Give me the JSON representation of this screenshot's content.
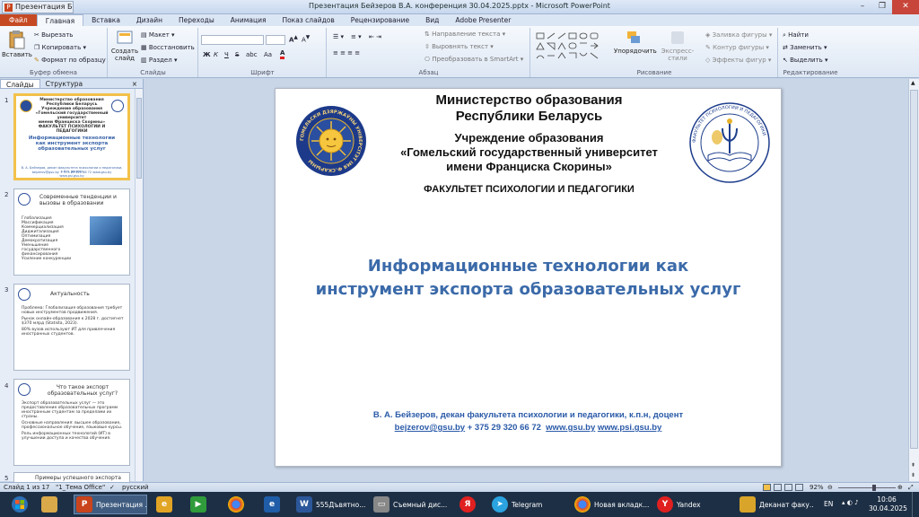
{
  "window": {
    "title": "Презентация Бейзеров В.А. конференция 30.04.2025.pptx - Microsoft PowerPoint",
    "quick_label": "Презентация Бей"
  },
  "tabs": [
    "Файл",
    "Главная",
    "Вставка",
    "Дизайн",
    "Переходы",
    "Анимация",
    "Показ слайдов",
    "Рецензирование",
    "Вид",
    "Adobe Presenter"
  ],
  "ribbon": {
    "clipboard": {
      "paste": "Вставить",
      "cut": "Вырезать",
      "copy": "Копировать",
      "format": "Формат по образцу",
      "label": "Буфер обмена"
    },
    "slides": {
      "new": "Создать слайд",
      "layout": "Макет",
      "reset": "Восстановить",
      "section": "Раздел",
      "label": "Слайды"
    },
    "font": {
      "label": "Шрифт",
      "bold": "Ж",
      "italic": "К",
      "underline": "Ч",
      "strike": "S",
      "shadow": "abc",
      "size_up": "A",
      "size_down": "A",
      "case": "Aa"
    },
    "paragraph": {
      "direction": "Направление текста",
      "align": "Выровнять текст",
      "smartart": "Преобразовать в SmartArt",
      "label": "Абзац"
    },
    "drawing": {
      "arrange": "Упорядочить",
      "quick_styles": "Экспресс-стили",
      "fill": "Заливка фигуры",
      "outline": "Контур фигуры",
      "effects": "Эффекты фигур",
      "label": "Рисование"
    },
    "editing": {
      "find": "Найти",
      "replace": "Заменить",
      "select": "Выделить",
      "label": "Редактирование"
    }
  },
  "panel": {
    "tab_slides": "Слайды",
    "tab_outline": "Структура",
    "close": "×"
  },
  "thumbnails": [
    {
      "num": "1",
      "lines": [
        "Министерство образования",
        "Республики Беларусь",
        "Учреждение образования",
        "«Гомельский государственный университет",
        "имени Франциска Скорины»",
        "ФАКУЛЬТЕТ ПСИХОЛОГИИ И ПЕДАГОГИКИ"
      ],
      "title": "Информационные технологии как инструмент экспорта образовательных услуг",
      "footer": "В. А. Бейзеров, декан факультета психологии и педагогики, к.п.н, доцент",
      "footer2": "bejzerov@gsu.by  + 375 29 320 66 72  www.gsu.by  www.psi.gsu.by"
    },
    {
      "num": "2",
      "title": "Современные тенденции и вызовы в образовании",
      "bullets": [
        "Глобализация",
        "Массификация",
        "Коммерциализация",
        "Диджитализация",
        "Оптимизация",
        "Демократизация",
        "Уменьшение государственного финансирования",
        "Усиление конкуренции"
      ]
    },
    {
      "num": "3",
      "title": "Актуальность",
      "bullets": [
        "Проблема: Глобализация образования требует новых инструментов продвижения.",
        "Рынок онлайн-образования к 2028 г. достигнет $370 млрд (Statista, 2023).",
        "80% вузов используют ИТ для привлечения иностранных студентов."
      ]
    },
    {
      "num": "4",
      "title": "Что такое экспорт образовательных услуг?",
      "bullets": [
        "Экспорт образовательных услуг — это предоставление образовательных программ иностранным студентам за пределами их страны.",
        "Основные направления: высшее образование, профессиональное обучение, языковые курсы.",
        "Роль информационных технологий (ИТ) в улучшении доступа и качества обучения."
      ]
    },
    {
      "num": "5",
      "title": "Примеры успешного экспорта"
    }
  ],
  "slide": {
    "header1": "Министерство образования",
    "header2": "Республики Беларусь",
    "inst1": "Учреждение образования",
    "inst2": "«Гомельский государственный университет",
    "inst3": "имени Франциска Скорины»",
    "faculty": "ФАКУЛЬТЕТ ПСИХОЛОГИИ И ПЕДАГОГИКИ",
    "title1": "Информационные технологии как",
    "title2": "инструмент экспорта образовательных услуг",
    "author": "В. А. Бейзеров, декан факультета психологии и педагогики, к.п.н, доцент",
    "email": "bejzerov@gsu.by",
    "phone": "+ 375 29 320 66 72",
    "site1": "www.gsu.by",
    "site2": "www.psi.gsu.by",
    "logo_left_text": "ГОМЕЛЬСКИ ДЗЯРЖАЎНЫ УНІВЕРСІТЭТ ІМЯ Ф.СКАРЫНЫ",
    "logo_right_text": "ФАКУЛЬТЕТ ПСИХОЛОГИИ И ПЕДАГОГИКИ"
  },
  "status": {
    "slide": "Слайд 1 из 17",
    "theme": "\"1_Тема Office\"",
    "lang": "русский",
    "zoom": "92%",
    "zoom_level": 0.62
  },
  "taskbar": {
    "items": [
      {
        "label": "Презентация ...",
        "icon": "P",
        "color": "#c9441c"
      },
      {
        "label": "",
        "icon": "e",
        "color": "#e1a424"
      },
      {
        "label": "",
        "icon": "",
        "color": "#2f9b3a"
      },
      {
        "label": "",
        "icon": "",
        "color": "#1f5da8"
      },
      {
        "label": "555Дъвятно...",
        "icon": "W",
        "color": "#2b579a"
      },
      {
        "label": "Съемный дис...",
        "icon": "",
        "color": "#888888"
      },
      {
        "label": "",
        "icon": "Я",
        "color": "#e02020"
      },
      {
        "label": "Telegram",
        "icon": "",
        "color": "#2aa3e0"
      },
      {
        "label": "Новая вкладк...",
        "icon": "",
        "color": "#2f9b3a"
      },
      {
        "label": "Yandex",
        "icon": "Y",
        "color": "#e02020"
      },
      {
        "label": "Деканат факу...",
        "icon": "",
        "color": "#d8a52a"
      }
    ],
    "lang": "EN",
    "time": "10:06",
    "date": "30.04.2025"
  }
}
